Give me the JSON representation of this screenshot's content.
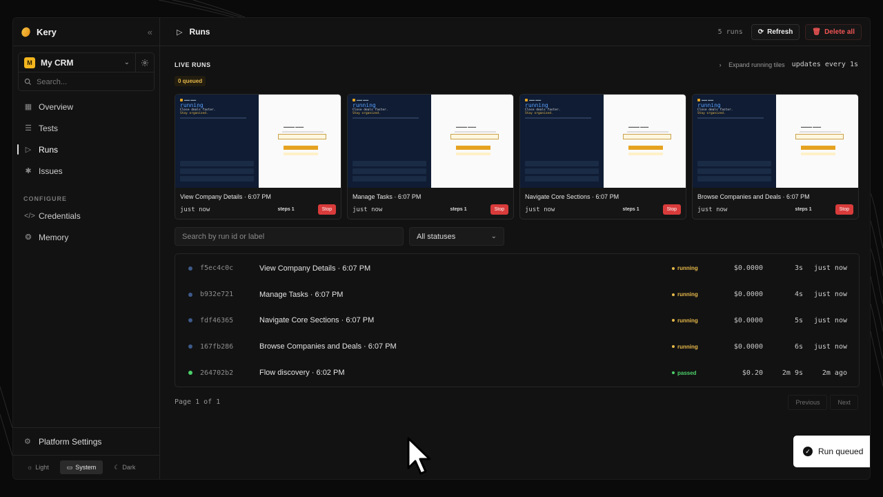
{
  "app": {
    "name": "Kery"
  },
  "workspace": {
    "initial": "M",
    "name": "My CRM",
    "search_placeholder": "Search..."
  },
  "nav": {
    "items": [
      {
        "label": "Overview",
        "icon": "grid-icon"
      },
      {
        "label": "Tests",
        "icon": "list-icon"
      },
      {
        "label": "Runs",
        "icon": "play-icon",
        "active": true
      },
      {
        "label": "Issues",
        "icon": "bug-icon"
      }
    ],
    "configure_label": "CONFIGURE",
    "configure_items": [
      {
        "label": "Credentials",
        "icon": "code-icon"
      },
      {
        "label": "Memory",
        "icon": "brain-icon"
      }
    ],
    "platform_settings": "Platform Settings"
  },
  "theme": {
    "light": "Light",
    "system": "System",
    "dark": "Dark",
    "active": "System"
  },
  "header": {
    "title": "Runs",
    "run_count": "5 runs",
    "refresh_label": "Refresh",
    "delete_all_label": "Delete all"
  },
  "live": {
    "title": "LIVE RUNS",
    "expand_label": "Expand running tiles",
    "updates_label": "updates every 1s",
    "queued_label": "0 queued",
    "tiles": [
      {
        "label": "View Company Details · 6:07 PM",
        "time": "just now",
        "steps": "steps 1",
        "stop": "Stop",
        "preview_status": "running",
        "preview_line1": "Close deals faster.",
        "preview_line2": "Stay organized."
      },
      {
        "label": "Manage Tasks · 6:07 PM",
        "time": "just now",
        "steps": "steps 1",
        "stop": "Stop",
        "preview_status": "running",
        "preview_line1": "Close deals faster.",
        "preview_line2": "Stay organized."
      },
      {
        "label": "Navigate Core Sections · 6:07 PM",
        "time": "just now",
        "steps": "steps 1",
        "stop": "Stop",
        "preview_status": "running",
        "preview_line1": "Close deals faster.",
        "preview_line2": "Stay organized."
      },
      {
        "label": "Browse Companies and Deals · 6:07 PM",
        "time": "just now",
        "steps": "steps 1",
        "stop": "Stop",
        "preview_status": "running",
        "preview_line1": "Close deals faster.",
        "preview_line2": "Stay organized."
      }
    ]
  },
  "filters": {
    "search_placeholder": "Search by run id or label",
    "status_value": "All statuses"
  },
  "runs": [
    {
      "id": "f5ec4c0c",
      "label": "View Company Details · 6:07 PM",
      "status": "running",
      "cost": "$0.0000",
      "duration": "3s",
      "ago": "just now",
      "color": "#e6b84a",
      "dot": "#3d5a8a"
    },
    {
      "id": "b932e721",
      "label": "Manage Tasks · 6:07 PM",
      "status": "running",
      "cost": "$0.0000",
      "duration": "4s",
      "ago": "just now",
      "color": "#e6b84a",
      "dot": "#3d5a8a"
    },
    {
      "id": "fdf46365",
      "label": "Navigate Core Sections · 6:07 PM",
      "status": "running",
      "cost": "$0.0000",
      "duration": "5s",
      "ago": "just now",
      "color": "#e6b84a",
      "dot": "#3d5a8a"
    },
    {
      "id": "167fb286",
      "label": "Browse Companies and Deals · 6:07 PM",
      "status": "running",
      "cost": "$0.0000",
      "duration": "6s",
      "ago": "just now",
      "color": "#e6b84a",
      "dot": "#3d5a8a"
    },
    {
      "id": "264702b2",
      "label": "Flow discovery · 6:02 PM",
      "status": "passed",
      "cost": "$0.20",
      "duration": "2m 9s",
      "ago": "2m ago",
      "color": "#4cd06a",
      "dot": "#4cd06a"
    }
  ],
  "pagination": {
    "label": "Page 1 of 1",
    "previous": "Previous",
    "next": "Next"
  },
  "toast": {
    "message": "Run queued"
  }
}
